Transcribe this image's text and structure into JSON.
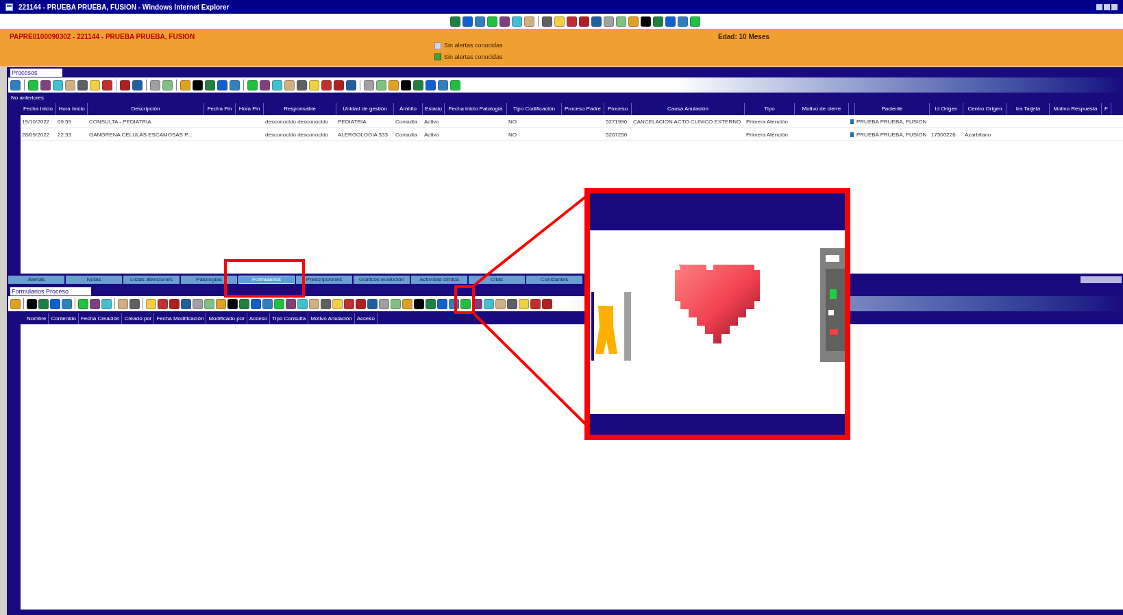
{
  "window": {
    "title": "221144 - PRUEBA PRUEBA, FUSION - Windows Internet Explorer"
  },
  "patient": {
    "id_line": "PAPRE0100090302 - 221144 - PRUEBA PRUEBA, FUSION",
    "age": "Edad: 10 Meses",
    "alerts": [
      "Sin alertas conocidas",
      "Sin alertas conocidas"
    ]
  },
  "processes": {
    "title": "Procesos",
    "subtitle": "No anteriores",
    "columns": [
      {
        "label": "Fecha Inicio"
      },
      {
        "label": "Hora Inicio"
      },
      {
        "label": "Descripción"
      },
      {
        "label": "Fecha Fin"
      },
      {
        "label": "Hora Fin"
      },
      {
        "label": "Responsable"
      },
      {
        "label": "Unidad de gestión"
      },
      {
        "label": "Ámbito"
      },
      {
        "label": "Estado"
      },
      {
        "label": "Fecha inicio Patología"
      },
      {
        "label": "Tipo Codificación"
      },
      {
        "label": "Proceso Padre"
      },
      {
        "label": "Proceso"
      },
      {
        "label": "Causa Anulación"
      },
      {
        "label": "Tipo"
      },
      {
        "label": "Motivo de cierre"
      },
      {
        "kind": "icon"
      },
      {
        "label": "Paciente"
      },
      {
        "label": "Id Origen"
      },
      {
        "label": "Centro Origen"
      },
      {
        "label": "Ira Tarjeta"
      },
      {
        "label": "Motivo Respuesta"
      },
      {
        "label": "F"
      }
    ],
    "rows": [
      {
        "cells": [
          "19/10/2022",
          "09:59",
          "CONSULTA - PEDIATRIA",
          null,
          null,
          "desconocido desconocido",
          "PEDIATRIA",
          "Consulta",
          "Activo",
          null,
          "NO",
          null,
          "5271996",
          "CANCELACION ACTO CLINICO EXTERNO",
          "Primera Atención",
          null,
          null,
          "PRUEBA PRUEBA, FUSION",
          null,
          null,
          null,
          null,
          null
        ]
      },
      {
        "cells": [
          "28/09/2022",
          "22:33",
          "GANGRENA CELULAS ESCAMOSAS P...",
          null,
          null,
          "desconocido desconocido",
          "ALERGOLOGIA 333",
          "Consulta",
          "Activo",
          null,
          "NO",
          null,
          "5267250",
          null,
          "Primera Atención",
          null,
          null,
          "PRUEBA PRUEBA, FUSION",
          "17500226",
          "Azarbitano",
          null,
          null,
          null
        ]
      }
    ]
  },
  "tabs": [
    {
      "label": "Alertas",
      "selected": false
    },
    {
      "label": "Notas",
      "selected": false
    },
    {
      "label": "Listas atenciones",
      "selected": false
    },
    {
      "label": "Patologías",
      "selected": false
    },
    {
      "label": "Formularios",
      "selected": true
    },
    {
      "label": "Prescripciones",
      "selected": false
    },
    {
      "label": "Gráficos evolución",
      "selected": false
    },
    {
      "label": "Actividad clínica",
      "selected": false
    },
    {
      "label": "Citas",
      "selected": false
    },
    {
      "label": "Constantes",
      "selected": false
    }
  ],
  "forms": {
    "title": "Formularios Proceso",
    "columns": [
      "Nombre",
      "Contenido",
      "Fecha Creación",
      "Creado por",
      "Fecha Modificación",
      "Modificado por",
      "Acceso",
      "Tipo Consulta",
      "Motivo Anulación",
      "Acceso"
    ]
  }
}
